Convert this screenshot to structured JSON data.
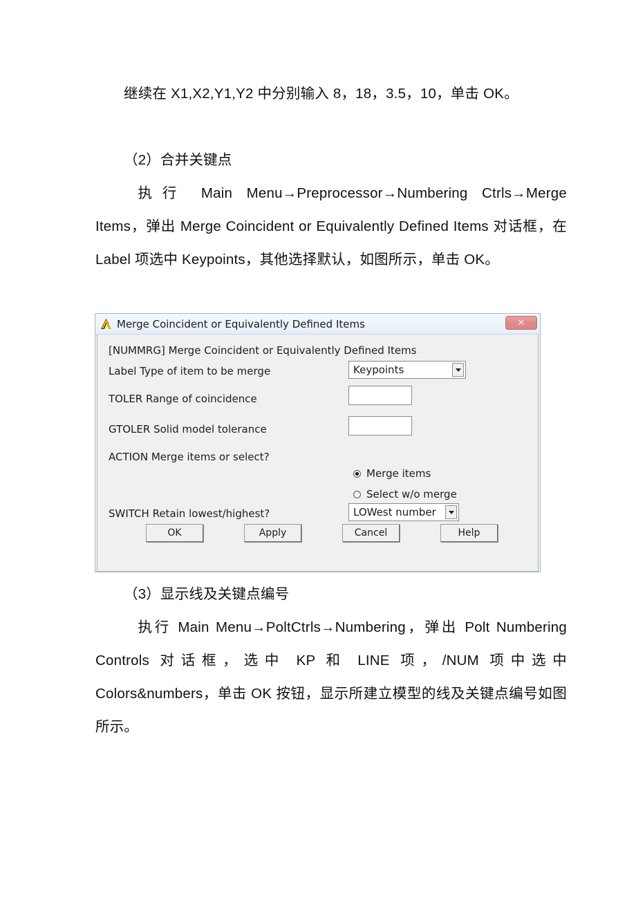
{
  "document": {
    "paragraphs": [
      {
        "id": "p1",
        "text": "继续在 X1,X2,Y1,Y2 中分别输入 8，18，3.5，10，单击 OK。"
      },
      {
        "id": "p2",
        "text": "（2）合并关键点"
      },
      {
        "id": "p3",
        "text": "执行 Main Menu→Preprocessor→Numbering Ctrls→Merge Items，弹出 Merge Coincident or Equivalently Defined Items 对话框，在 Label 项选中 Keypoints，其他选择默认，如图所示，单击 OK。"
      },
      {
        "id": "p4",
        "text": "（3）显示线及关键点编号"
      },
      {
        "id": "p5",
        "text": "执行 Main Menu→PoltCtrls→Numbering，弹出 Polt Numbering Controls 对话框，选中 KP 和 LINE 项，/NUM 项中选中 Colors&numbers，单击 OK 按钮，显示所建立模型的线及关键点编号如图所示。"
      }
    ]
  },
  "dialog": {
    "title": "Merge Coincident or Equivalently Defined Items",
    "close_label": "✕",
    "icon": "ansys-logo-icon",
    "header_command": "[NUMMRG]  Merge Coincident or Equivalently Defined Items",
    "fields": [
      {
        "key": "Label",
        "label": "Label   Type of item to be merge",
        "control": "combo",
        "value": "Keypoints"
      },
      {
        "key": "TOLER",
        "label": "TOLER   Range of coincidence",
        "control": "text",
        "value": ""
      },
      {
        "key": "GTOLER",
        "label": "GTOLER  Solid model tolerance",
        "control": "text",
        "value": ""
      },
      {
        "key": "ACTION",
        "label": "ACTION  Merge items or select?",
        "control": "radio-group",
        "value": "Merge items"
      },
      {
        "key": "SWITCH",
        "label": "SWITCH  Retain lowest/highest?",
        "control": "combo",
        "value": "LOWest number"
      }
    ],
    "radios": [
      {
        "label": "Merge items",
        "selected": true
      },
      {
        "label": "Select w/o merge",
        "selected": false
      }
    ],
    "buttons": [
      {
        "label": "OK"
      },
      {
        "label": "Apply"
      },
      {
        "label": "Cancel"
      },
      {
        "label": "Help"
      }
    ],
    "colors": {
      "face": "#f0f0f0",
      "titlebar": "#eef4fa",
      "border": "#9fb8d4",
      "close_button": "#dd8c8c",
      "icon_yellow": "#f2b500"
    }
  }
}
